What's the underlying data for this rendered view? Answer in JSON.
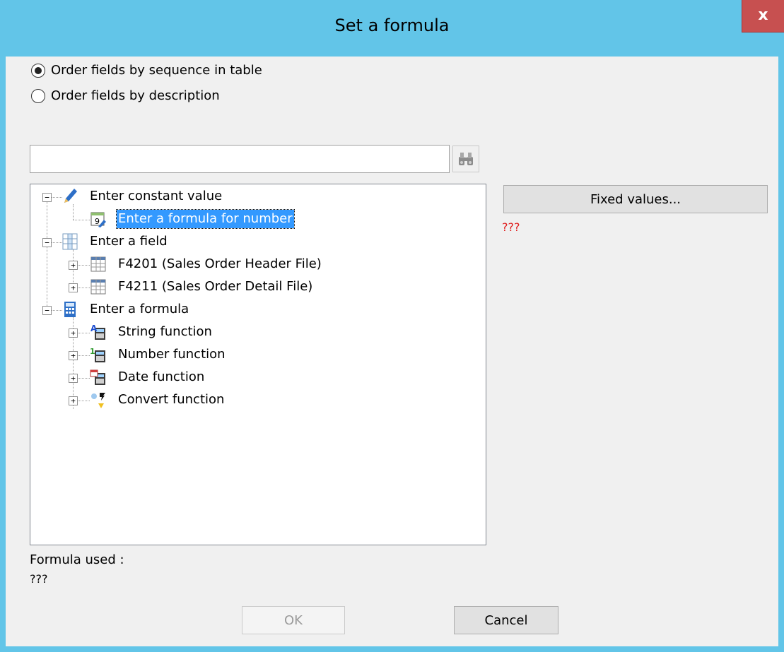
{
  "window": {
    "title": "Set a formula",
    "close_label": "x"
  },
  "ordering": {
    "options": [
      {
        "label": "Order fields by sequence in table",
        "checked": true
      },
      {
        "label": "Order fields by description",
        "checked": false
      }
    ]
  },
  "search": {
    "value": "",
    "placeholder": ""
  },
  "tree": {
    "constant": {
      "label": "Enter constant value",
      "child": "Enter a formula for number"
    },
    "field": {
      "label": "Enter a field",
      "children": [
        "F4201 (Sales Order Header File)",
        "F4211 (Sales Order Detail File)"
      ]
    },
    "formula": {
      "label": "Enter a formula",
      "children": [
        "String function",
        "Number function",
        "Date function",
        "Convert function"
      ]
    }
  },
  "side": {
    "fixed_values_label": "Fixed values...",
    "status": "???"
  },
  "footer": {
    "formula_used_label": "Formula used :",
    "formula_used_value": "???",
    "ok_label": "OK",
    "cancel_label": "Cancel"
  },
  "colors": {
    "titlebar": "#62c5e8",
    "close": "#c75050",
    "selection": "#3399ff",
    "error": "#e02020"
  }
}
